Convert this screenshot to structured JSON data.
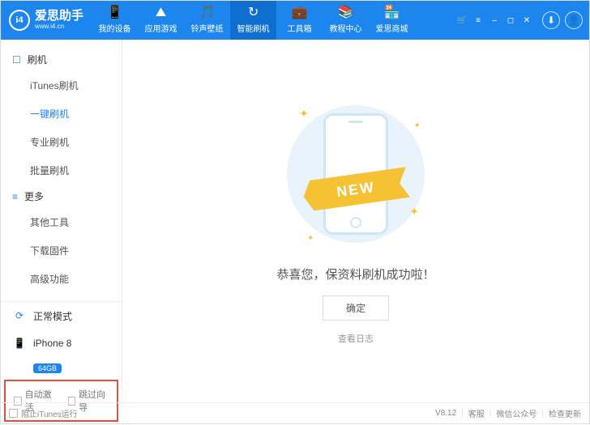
{
  "logo": {
    "badge": "i4",
    "title": "爱思助手",
    "subtitle": "www.i4.cn"
  },
  "nav": [
    {
      "label": "我的设备",
      "icon": "📱"
    },
    {
      "label": "应用游戏",
      "icon": "⛰"
    },
    {
      "label": "铃声壁纸",
      "icon": "🎵"
    },
    {
      "label": "智能刷机",
      "icon": "↻",
      "active": true
    },
    {
      "label": "工具箱",
      "icon": "💼"
    },
    {
      "label": "教程中心",
      "icon": "📚"
    },
    {
      "label": "爱思商城",
      "icon": "🏪"
    }
  ],
  "sidebar": {
    "groups": [
      {
        "title": "刷机",
        "icon": "☐",
        "items": [
          "iTunes刷机",
          "一键刷机",
          "专业刷机",
          "批量刷机"
        ],
        "activeIndex": 1
      },
      {
        "title": "更多",
        "icon": "≡",
        "items": [
          "其他工具",
          "下载固件",
          "高级功能"
        ],
        "activeIndex": -1
      }
    ],
    "mode": {
      "label": "正常模式",
      "icon": "⟳"
    },
    "device": {
      "name": "iPhone 8",
      "storage": "64GB",
      "icon": "📱"
    },
    "checks": {
      "auto_activate": "自动激活",
      "skip_wizard": "跳过向导"
    }
  },
  "main": {
    "ribbon": "NEW",
    "success": "恭喜您，保资料刷机成功啦！",
    "ok": "确定",
    "log": "查看日志"
  },
  "status": {
    "block_itunes": "阻止iTunes运行",
    "version": "V8.12",
    "links": [
      "客服",
      "微信公众号",
      "检查更新"
    ]
  }
}
